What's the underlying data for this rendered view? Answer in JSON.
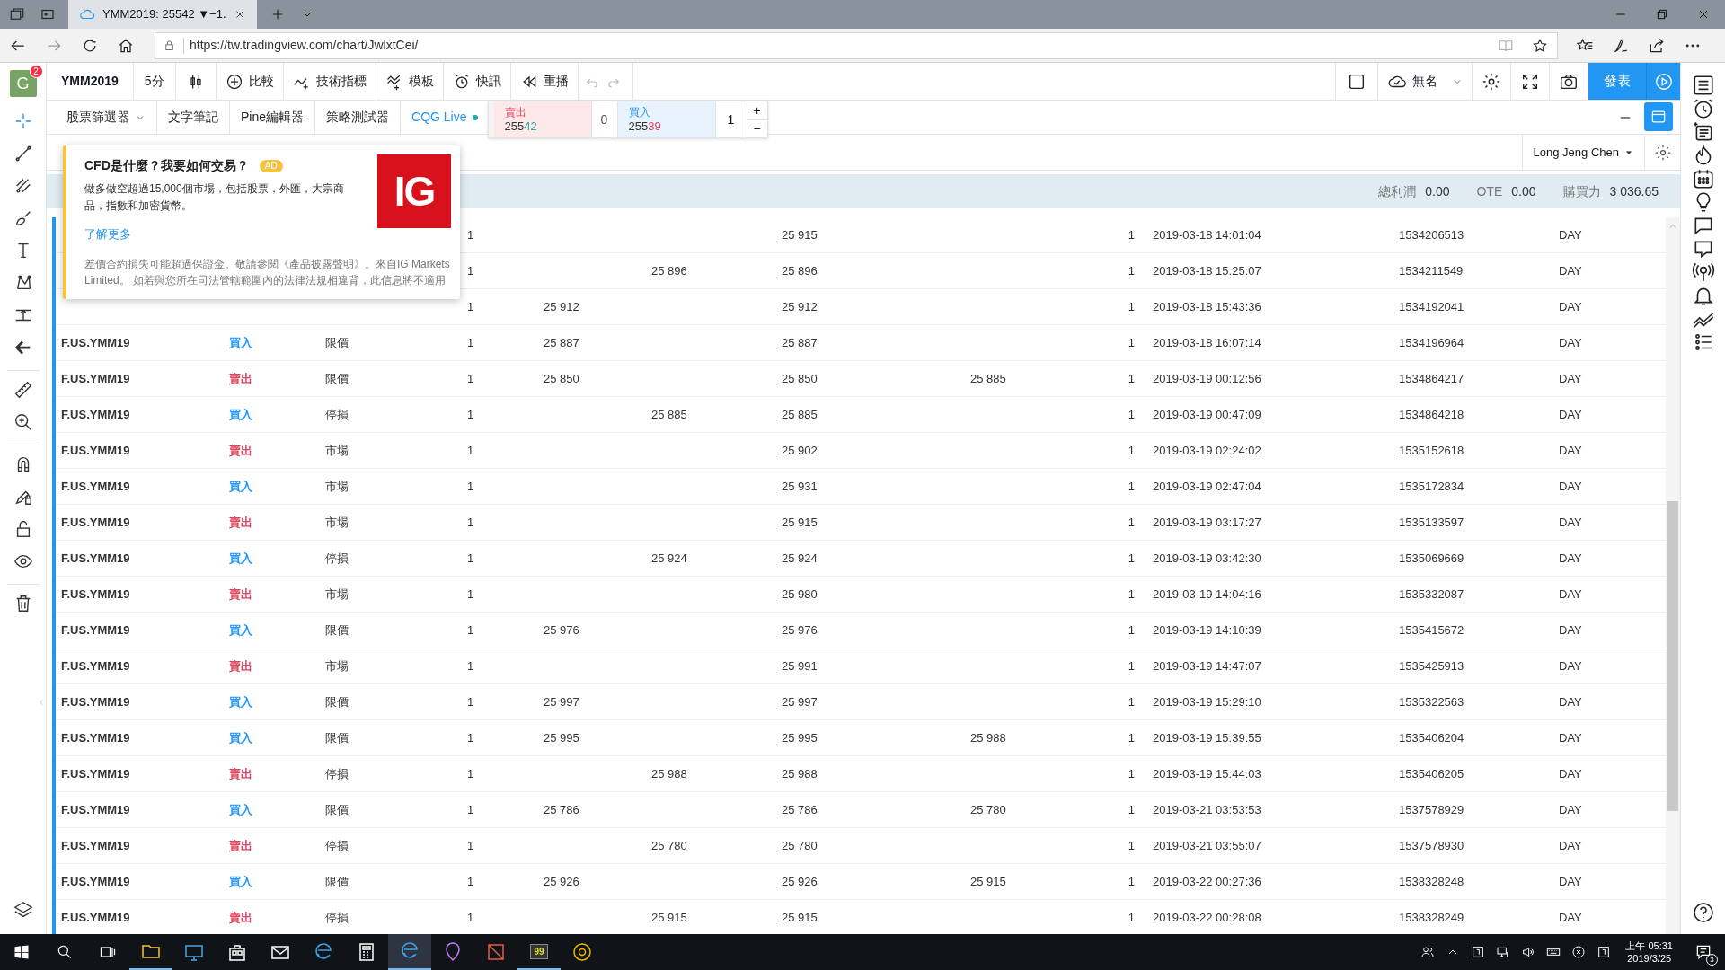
{
  "browser": {
    "tab_title": "YMM2019: 25542 ▼−1.",
    "url": "https://tw.tradingview.com/chart/JwlxtCei/"
  },
  "avatar": {
    "letter": "G",
    "badge": "2"
  },
  "toolbar": {
    "symbol": "YMM2019",
    "interval": "5分",
    "buttons": [
      {
        "kind": "compare",
        "label": "比較"
      },
      {
        "kind": "indicators",
        "label": "技術指標"
      },
      {
        "kind": "templates",
        "label": "模板"
      },
      {
        "kind": "alerts",
        "label": "快訊"
      },
      {
        "kind": "replay",
        "label": "重播"
      }
    ],
    "layout_name": "無名",
    "publish": "發表"
  },
  "panel_tabs": [
    {
      "label": "股票篩選器",
      "dropdown": true,
      "selected": false,
      "connected": false
    },
    {
      "label": "文字筆記",
      "dropdown": false,
      "selected": false,
      "connected": false
    },
    {
      "label": "Pine編輯器",
      "dropdown": false,
      "selected": false,
      "connected": false
    },
    {
      "label": "策略測試器",
      "dropdown": false,
      "selected": false,
      "connected": false
    },
    {
      "label": "CQG Live",
      "dropdown": false,
      "selected": true,
      "connected": true
    }
  ],
  "order_widget": {
    "sell": {
      "label": "賣出",
      "price_lead": "255",
      "price_tail": "42"
    },
    "spread": "0",
    "buy": {
      "label": "買入",
      "price_lead": "255",
      "price_tail": "39"
    },
    "quantity": "1",
    "plus": "+",
    "minus": "−"
  },
  "account": {
    "name": "Long Jeng Chen"
  },
  "summary": [
    {
      "label": "總利潤",
      "value": "0.00"
    },
    {
      "label": "OTE",
      "value": "0.00"
    },
    {
      "label": "購買力",
      "value": "3 036.65"
    }
  ],
  "orders": [
    {
      "column_4": "1",
      "column_7": "25 915",
      "column_9": "1",
      "column_10": "2019-03-18 14:01:04",
      "column_11": "1534206513",
      "column_12": "DAY"
    },
    {
      "column_4": "1",
      "column_6": "25 896",
      "column_7": "25 896",
      "column_9": "1",
      "column_10": "2019-03-18 15:25:07",
      "column_11": "1534211549",
      "column_12": "DAY"
    },
    {
      "column_4": "1",
      "column_5": "25 912",
      "column_7": "25 912",
      "column_9": "1",
      "column_10": "2019-03-18 15:43:36",
      "column_11": "1534192041",
      "column_12": "DAY"
    },
    {
      "column_1": "F.US.YMM19",
      "column_2": "買入",
      "color": "#2196f3",
      "column_3": "限價",
      "column_4": "1",
      "column_5": "25 887",
      "column_7": "25 887",
      "column_9": "1",
      "column_10": "2019-03-18 16:07:14",
      "column_11": "1534196964",
      "column_12": "DAY"
    },
    {
      "column_1": "F.US.YMM19",
      "column_2": "賣出",
      "color": "#e0435a",
      "column_3": "限價",
      "column_4": "1",
      "column_5": "25 850",
      "column_7": "25 850",
      "column_8": "25 885",
      "column_9": "1",
      "column_10": "2019-03-19 00:12:56",
      "column_11": "1534864217",
      "column_12": "DAY"
    },
    {
      "column_1": "F.US.YMM19",
      "column_2": "買入",
      "color": "#2196f3",
      "column_3": "停損",
      "column_4": "1",
      "column_6": "25 885",
      "column_7": "25 885",
      "column_9": "1",
      "column_10": "2019-03-19 00:47:09",
      "column_11": "1534864218",
      "column_12": "DAY"
    },
    {
      "column_1": "F.US.YMM19",
      "column_2": "賣出",
      "color": "#e0435a",
      "column_3": "市場",
      "column_4": "1",
      "column_7": "25 902",
      "column_9": "1",
      "column_10": "2019-03-19 02:24:02",
      "column_11": "1535152618",
      "column_12": "DAY"
    },
    {
      "column_1": "F.US.YMM19",
      "column_2": "買入",
      "color": "#2196f3",
      "column_3": "市場",
      "column_4": "1",
      "column_7": "25 931",
      "column_9": "1",
      "column_10": "2019-03-19 02:47:04",
      "column_11": "1535172834",
      "column_12": "DAY"
    },
    {
      "column_1": "F.US.YMM19",
      "column_2": "賣出",
      "color": "#e0435a",
      "column_3": "市場",
      "column_4": "1",
      "column_7": "25 915",
      "column_9": "1",
      "column_10": "2019-03-19 03:17:27",
      "column_11": "1535133597",
      "column_12": "DAY"
    },
    {
      "column_1": "F.US.YMM19",
      "column_2": "買入",
      "color": "#2196f3",
      "column_3": "停損",
      "column_4": "1",
      "column_6": "25 924",
      "column_7": "25 924",
      "column_9": "1",
      "column_10": "2019-03-19 03:42:30",
      "column_11": "1535069669",
      "column_12": "DAY"
    },
    {
      "column_1": "F.US.YMM19",
      "column_2": "賣出",
      "color": "#e0435a",
      "column_3": "市場",
      "column_4": "1",
      "column_7": "25 980",
      "column_9": "1",
      "column_10": "2019-03-19 14:04:16",
      "column_11": "1535332087",
      "column_12": "DAY"
    },
    {
      "column_1": "F.US.YMM19",
      "column_2": "買入",
      "color": "#2196f3",
      "column_3": "限價",
      "column_4": "1",
      "column_5": "25 976",
      "column_7": "25 976",
      "column_9": "1",
      "column_10": "2019-03-19 14:10:39",
      "column_11": "1535415672",
      "column_12": "DAY"
    },
    {
      "column_1": "F.US.YMM19",
      "column_2": "賣出",
      "color": "#e0435a",
      "column_3": "市場",
      "column_4": "1",
      "column_7": "25 991",
      "column_9": "1",
      "column_10": "2019-03-19 14:47:07",
      "column_11": "1535425913",
      "column_12": "DAY"
    },
    {
      "column_1": "F.US.YMM19",
      "column_2": "買入",
      "color": "#2196f3",
      "column_3": "限價",
      "column_4": "1",
      "column_5": "25 997",
      "column_7": "25 997",
      "column_9": "1",
      "column_10": "2019-03-19 15:29:10",
      "column_11": "1535322563",
      "column_12": "DAY"
    },
    {
      "column_1": "F.US.YMM19",
      "column_2": "買入",
      "color": "#2196f3",
      "column_3": "限價",
      "column_4": "1",
      "column_5": "25 995",
      "column_7": "25 995",
      "column_8": "25 988",
      "column_9": "1",
      "column_10": "2019-03-19 15:39:55",
      "column_11": "1535406204",
      "column_12": "DAY"
    },
    {
      "column_1": "F.US.YMM19",
      "column_2": "賣出",
      "color": "#e0435a",
      "column_3": "停損",
      "column_4": "1",
      "column_6": "25 988",
      "column_7": "25 988",
      "column_9": "1",
      "column_10": "2019-03-19 15:44:03",
      "column_11": "1535406205",
      "column_12": "DAY"
    },
    {
      "column_1": "F.US.YMM19",
      "column_2": "買入",
      "color": "#2196f3",
      "column_3": "限價",
      "column_4": "1",
      "column_5": "25 786",
      "column_7": "25 786",
      "column_8": "25 780",
      "column_9": "1",
      "column_10": "2019-03-21 03:53:53",
      "column_11": "1537578929",
      "column_12": "DAY"
    },
    {
      "column_1": "F.US.YMM19",
      "column_2": "賣出",
      "color": "#e0435a",
      "column_3": "停損",
      "column_4": "1",
      "column_6": "25 780",
      "column_7": "25 780",
      "column_9": "1",
      "column_10": "2019-03-21 03:55:07",
      "column_11": "1537578930",
      "column_12": "DAY"
    },
    {
      "column_1": "F.US.YMM19",
      "column_2": "買入",
      "color": "#2196f3",
      "column_3": "限價",
      "column_4": "1",
      "column_5": "25 926",
      "column_7": "25 926",
      "column_8": "25 915",
      "column_9": "1",
      "column_10": "2019-03-22 00:27:36",
      "column_11": "1538328248",
      "column_12": "DAY"
    },
    {
      "column_1": "F.US.YMM19",
      "column_2": "賣出",
      "color": "#e0435a",
      "column_3": "停損",
      "column_4": "1",
      "column_6": "25 915",
      "column_7": "25 915",
      "column_9": "1",
      "column_10": "2019-03-22 00:28:08",
      "column_11": "1538328249",
      "column_12": "DAY"
    }
  ],
  "ad": {
    "title": "CFD是什麼？我要如何交易？",
    "badge": "AD",
    "body": "做多做空超過15,000個市場，包括股票，外匯，大宗商品，指數和加密貨幣。",
    "link": "了解更多",
    "disclaimer": "差價合約損失可能超過保證金。敬請參閱《產品披露聲明》。來自IG Markets Limited。 如若與您所在司法管轄範圍內的法律法規相違背，此信息將不適用",
    "logo_text": "IG"
  },
  "taskbar": {
    "app_label": "99",
    "time": "上午 05:31",
    "date": "2019/3/25",
    "notifications": "3"
  }
}
